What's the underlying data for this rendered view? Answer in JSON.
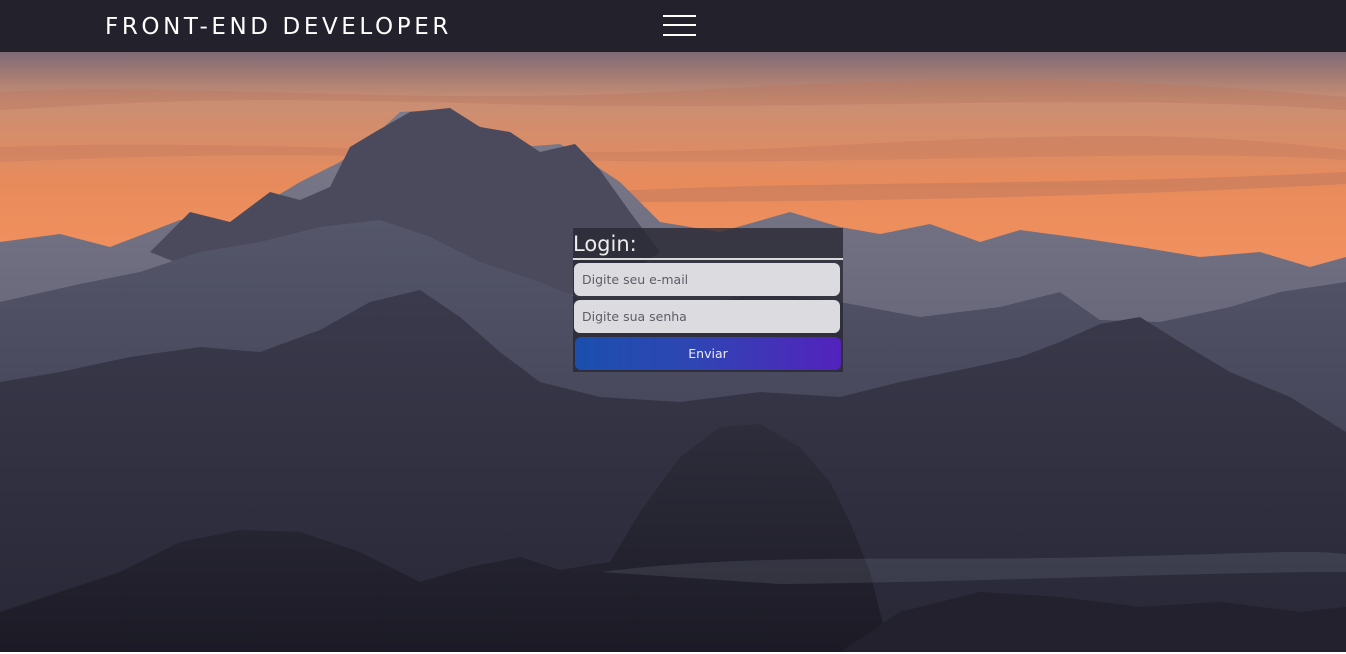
{
  "header": {
    "brand": "FRONT-END DEVELOPER",
    "menu_icon": "hamburger-menu-icon"
  },
  "hero": {
    "image": "mountain-sunset-landscape"
  },
  "login": {
    "title": "Login:",
    "email_placeholder": "Digite seu e-mail",
    "password_placeholder": "Digite sua senha",
    "submit_label": "Enviar"
  },
  "colors": {
    "navbar": "#23222c",
    "button_start": "#1b4fae",
    "button_end": "#5322bd",
    "input_bg": "#dcdbe0"
  }
}
